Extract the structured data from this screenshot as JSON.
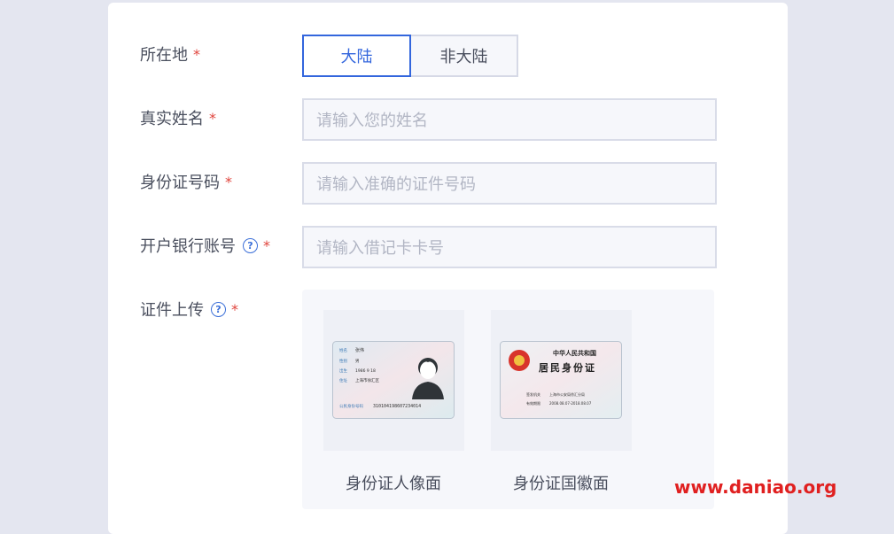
{
  "form": {
    "location": {
      "label": "所在地",
      "options": [
        "大陆",
        "非大陆"
      ],
      "selected": "大陆"
    },
    "real_name": {
      "label": "真实姓名",
      "placeholder": "请输入您的姓名"
    },
    "id_number": {
      "label": "身份证号码",
      "placeholder": "请输入准确的证件号码"
    },
    "bank_account": {
      "label": "开户银行账号",
      "placeholder": "请输入借记卡卡号"
    },
    "upload": {
      "label": "证件上传",
      "front_caption": "身份证人像面",
      "back_caption": "身份证国徽面",
      "front_sample": {
        "name_label": "姓名",
        "name": "张伟",
        "gender_label": "性别",
        "gender": "男",
        "ethnic_label": "民族",
        "ethnic": "汉",
        "birth_label": "出生",
        "birth": "1986 9 18",
        "address_label": "住址",
        "address": "上海市徐汇区",
        "id_label": "公民身份号码",
        "id": "310104198607234014"
      },
      "back_sample": {
        "title_small": "中华人民共和国",
        "title_large": "居民身份证",
        "authority_label": "签发机关",
        "authority": "上海市公安局徐汇分局",
        "validity_label": "有效期限",
        "validity": "2008.08.07-2018.08.07"
      }
    },
    "required_mark": "*",
    "help_icon_glyph": "?"
  },
  "watermark": "www.daniao.org",
  "colors": {
    "accent": "#3366dd",
    "required": "#e0443c",
    "watermark": "#e02020"
  }
}
